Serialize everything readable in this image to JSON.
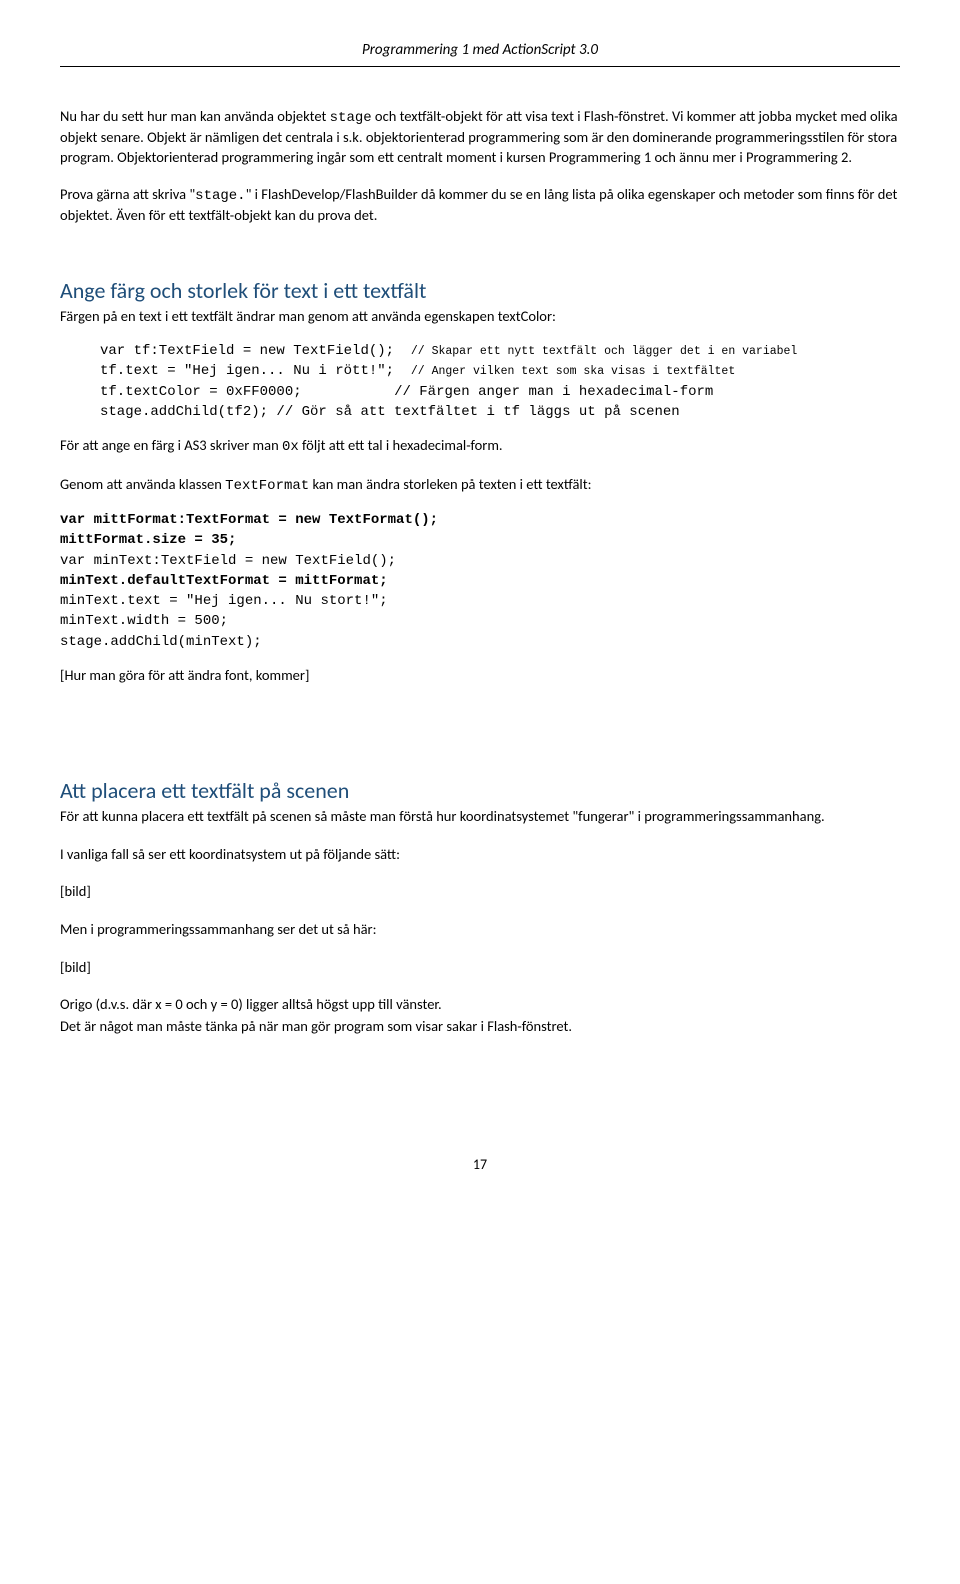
{
  "header": "Programmering 1 med ActionScript 3.0",
  "p1a": "Nu har du sett hur man kan använda objektet ",
  "p1_mono1": "stage",
  "p1b": " och textfält-objekt för att visa text i Flash-fönstret. Vi kommer att jobba mycket med olika objekt senare. Objekt är nämligen det centrala i s.k. objektorienterad programmering som är den dominerande programmeringsstilen för stora program. Objektorienterad programmering ingår som ett centralt moment i kursen Programmering 1 och ännu mer i Programmering 2.",
  "p2a": "Prova gärna att skriva \"",
  "p2_mono": "stage.",
  "p2b": "\" i FlashDevelop/FlashBuilder då kommer du se en lång lista på olika egenskaper och metoder som finns för det objektet. Även för ett textfält-objekt kan du prova det.",
  "h1": "Ange färg och storlek för text i ett textfält",
  "p3": "Färgen på en text i ett textfält ändrar man genom att använda egenskapen textColor:",
  "code1": {
    "l1a": "var tf:TextField = new TextField();",
    "l1c": "// Skapar ett nytt textfält och lägger det i en variabel",
    "l2a": "tf.text = \"Hej igen... Nu i rött!\";",
    "l2c": "// Anger vilken text som ska visas i textfältet",
    "l3a": "tf.textColor = 0xFF0000;",
    "l3c": "// Färgen anger man i hexadecimal-form",
    "l4": "stage.addChild(tf2); // Gör så att textfältet i tf läggs ut på scenen"
  },
  "p4a": "För att ange en färg i AS3 skriver man ",
  "p4_mono": "0x",
  "p4b": " följt att ett tal i hexadecimal-form.",
  "p5a": "Genom att använda klassen ",
  "p5_mono": "TextFormat",
  "p5b": " kan man ändra storleken på texten i ett textfält:",
  "code2": {
    "l1": "var mittFormat:TextFormat = new TextFormat();",
    "l2": "mittFormat.size = 35;",
    "l3": "var minText:TextField = new TextField();",
    "l4": "minText.defaultTextFormat = mittFormat;",
    "l5": "minText.text = \"Hej igen... Nu stort!\";",
    "l6": "minText.width = 500;",
    "l7": "stage.addChild(minText);"
  },
  "p6": "[Hur man göra för att ändra font, kommer]",
  "h2": "Att placera ett textfält på scenen",
  "p7": "För att kunna placera ett textfält på scenen så måste man förstå hur koordinatsystemet \"fungerar\" i programmeringssammanhang.",
  "p8": "I vanliga fall så ser ett koordinatsystem ut på följande sätt:",
  "bild1": "[bild]",
  "p9": "Men i programmeringssammanhang ser det ut så här:",
  "bild2": "[bild]",
  "p10": "Origo (d.v.s. där x = 0 och y = 0) ligger alltså högst upp till vänster.",
  "p11": "Det är något man måste tänka på när man gör program som visar sakar i Flash-fönstret.",
  "pagenum": "17"
}
